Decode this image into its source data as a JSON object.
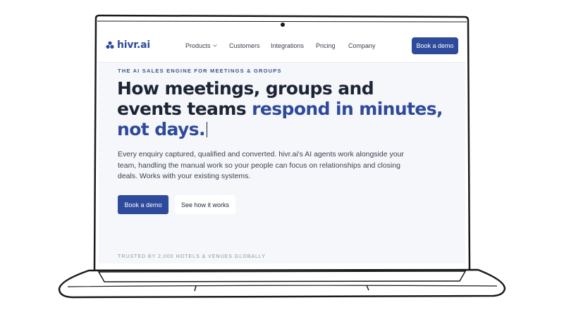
{
  "header": {
    "logo_text": "hivr.ai",
    "nav": [
      {
        "label": "Products",
        "has_dropdown": true
      },
      {
        "label": "Customers"
      },
      {
        "label": "Integrations"
      },
      {
        "label": "Pricing"
      },
      {
        "label": "Company"
      }
    ],
    "cta_label": "Book a demo"
  },
  "hero": {
    "eyebrow": "THE AI SALES ENGINE FOR MEETINGS & GROUPS",
    "headline_line1": "How meetings, groups and",
    "headline_line2_plain": "events teams ",
    "headline_line2_accent": "respond in minutes,",
    "headline_line3_accent": "not days.",
    "subtext": "Every enquiry captured, qualified and converted. hivr.ai's AI agents work alongside your team, handling the manual work so your people can focus on relationships and closing deals. Works with your existing systems.",
    "primary_button": "Book a demo",
    "secondary_button": "See how it works",
    "trusted_text": "TRUSTED BY 2,000 HOTELS & VENUES GLOBALLY"
  },
  "colors": {
    "brand": "#2e4a9a",
    "heading": "#1d2535",
    "hero_bg": "#f5f7fb"
  },
  "icons": {
    "logo": "three-dots-logo-icon",
    "dropdown": "chevron-down-icon",
    "webcam": "webcam-icon"
  }
}
